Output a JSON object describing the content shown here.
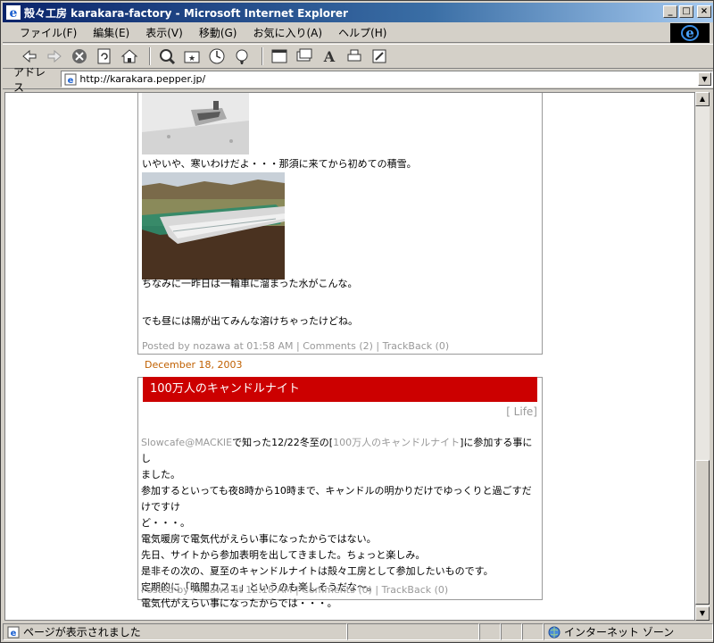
{
  "window": {
    "title": "殻々工房  karakara-factory - Microsoft Internet Explorer",
    "caption_buttons": [
      "_",
      "□",
      "×"
    ]
  },
  "menu": {
    "items": [
      "ファイル(F)",
      "編集(E)",
      "表示(V)",
      "移動(G)",
      "お気に入り(A)",
      "ヘルプ(H)"
    ]
  },
  "toolbar": {
    "buttons": [
      "back-icon",
      "forward-icon",
      "stop-icon",
      "refresh-icon",
      "home-icon",
      "search-icon",
      "favorites-icon",
      "history-icon",
      "channels-icon",
      "fullscreen-icon",
      "mail-icon",
      "font-icon",
      "print-icon",
      "edit-icon"
    ]
  },
  "address": {
    "label": "アドレス",
    "url": "http://karakara.pepper.jp/"
  },
  "post1": {
    "caption1": "いやいや、寒いわけだよ・・・那須に来てから初めての積雪。",
    "caption2": "ちなみに一昨日は一輪車に溜まった水がこんな。",
    "caption3": "でも昼には陽が出てみんな溶けちゃったけどね。",
    "footer": {
      "posted_by": "Posted by nozawa at",
      "time": "01:58 AM",
      "sep": "|",
      "comments": "Comments (2)",
      "trackback": "TrackBack (0)"
    }
  },
  "date_header": "December 18, 2003",
  "post2": {
    "title": "100万人のキャンドルナイト",
    "category": "[ Life]",
    "lines": [
      [
        "Slowcafe@MACKIE",
        "で知った12/22冬至の[",
        "100万人のキャンドルナイト",
        "]に参加する事にし"
      ],
      "ました。",
      "参加するといっても夜8時から10時まで、キャンドルの明かりだけでゆっくりと過ごすだけですけ",
      "ど・・・。",
      "電気暖房で電気代がえらい事になったからではない。",
      "先日、サイトから参加表明を出してきました。ちょっと楽しみ。",
      "是非その次の、夏至のキャンドルナイトは殻々工房として参加したいものです。",
      "定期的に「暗闇カフェ」というのも楽しそうだな～。",
      "電気代がえらい事になったからでは・・・。"
    ],
    "footer": {
      "posted_by": "Posted by nozawa at",
      "time": "12:18 AM",
      "sep": "|",
      "comments": "Comments (0)",
      "trackback": "TrackBack (0)"
    }
  },
  "status": {
    "text": "ページが表示されました",
    "zone": "インターネット ゾーン"
  }
}
